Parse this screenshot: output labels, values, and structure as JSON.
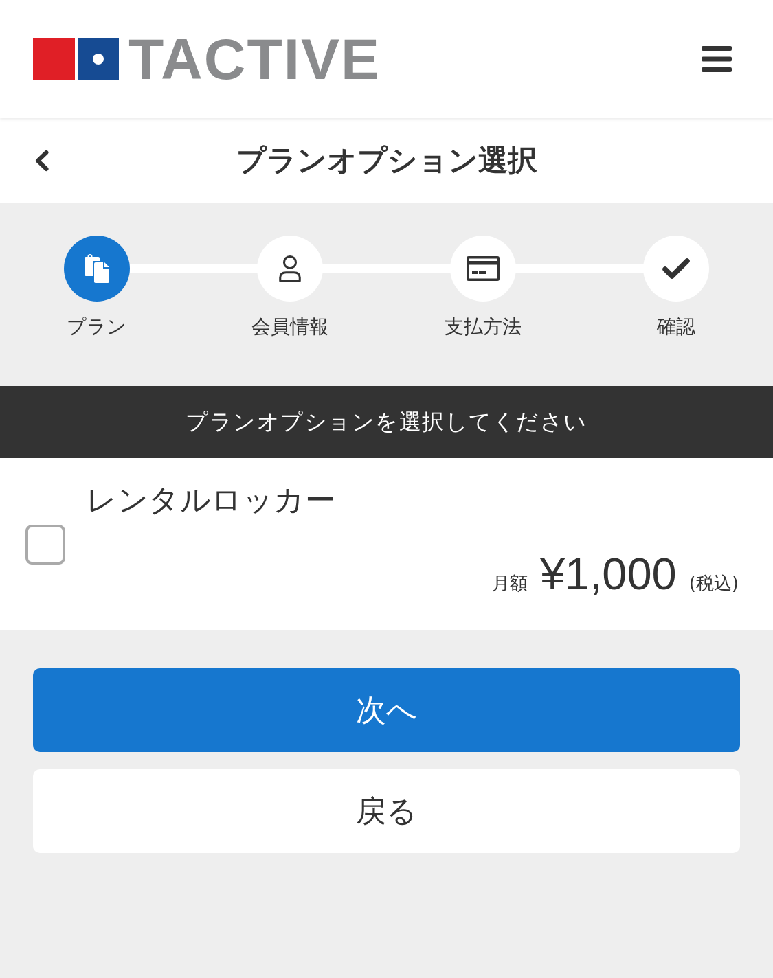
{
  "header": {
    "logo_text": "TACTIVE"
  },
  "page_title": "プランオプション選択",
  "steps": [
    {
      "kind": "documents",
      "label": "プラン",
      "selected": true
    },
    {
      "kind": "person",
      "label": "会員情報",
      "selected": false
    },
    {
      "kind": "card",
      "label": "支払方法",
      "selected": false
    },
    {
      "kind": "check",
      "label": "確認",
      "selected": false
    }
  ],
  "banner": {
    "text": "プランオプションを選択してください"
  },
  "options": [
    {
      "name": "レンタルロッカー",
      "checked": false,
      "price_label": "月額",
      "price": "¥1,000",
      "tax_note": "(税込)"
    }
  ],
  "buttons": [
    {
      "kind": "primary",
      "label": "次へ"
    },
    {
      "kind": "secondary",
      "label": "戻る"
    }
  ]
}
